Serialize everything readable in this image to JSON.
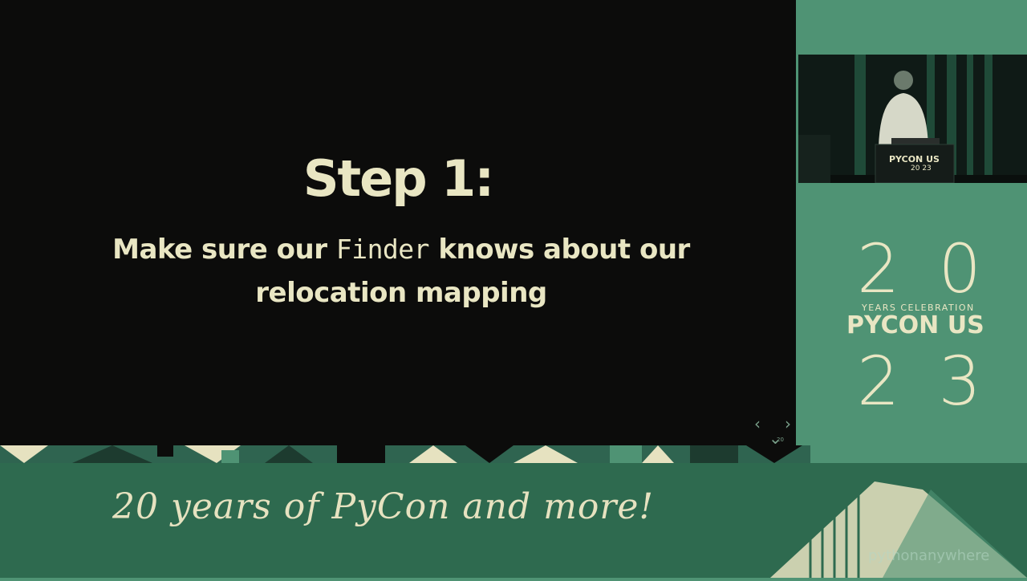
{
  "slide": {
    "title": "Step 1:",
    "body_pre": "Make sure our ",
    "body_code": "Finder",
    "body_post": " knows about our relocation mapping",
    "nav": {
      "prev_icon": "chevron-left-icon",
      "next_icon": "chevron-right-icon",
      "down_icon": "chevron-down-icon",
      "slide_number": "20"
    }
  },
  "camera": {
    "podium_label": "PYCON US",
    "podium_years": "20 23"
  },
  "event_logo": {
    "number_top": "20",
    "subtitle": "YEARS CELEBRATION",
    "name": "PYCON US",
    "number_bottom": "23"
  },
  "banner": {
    "tagline": "20 years of PyCon and more!",
    "sponsor": "pythonanywhere"
  },
  "colors": {
    "slide_bg": "#0c0c0b",
    "slide_text": "#e9e6c3",
    "brand_green": "#4f9374",
    "banner_green": "#2e6a4f"
  }
}
